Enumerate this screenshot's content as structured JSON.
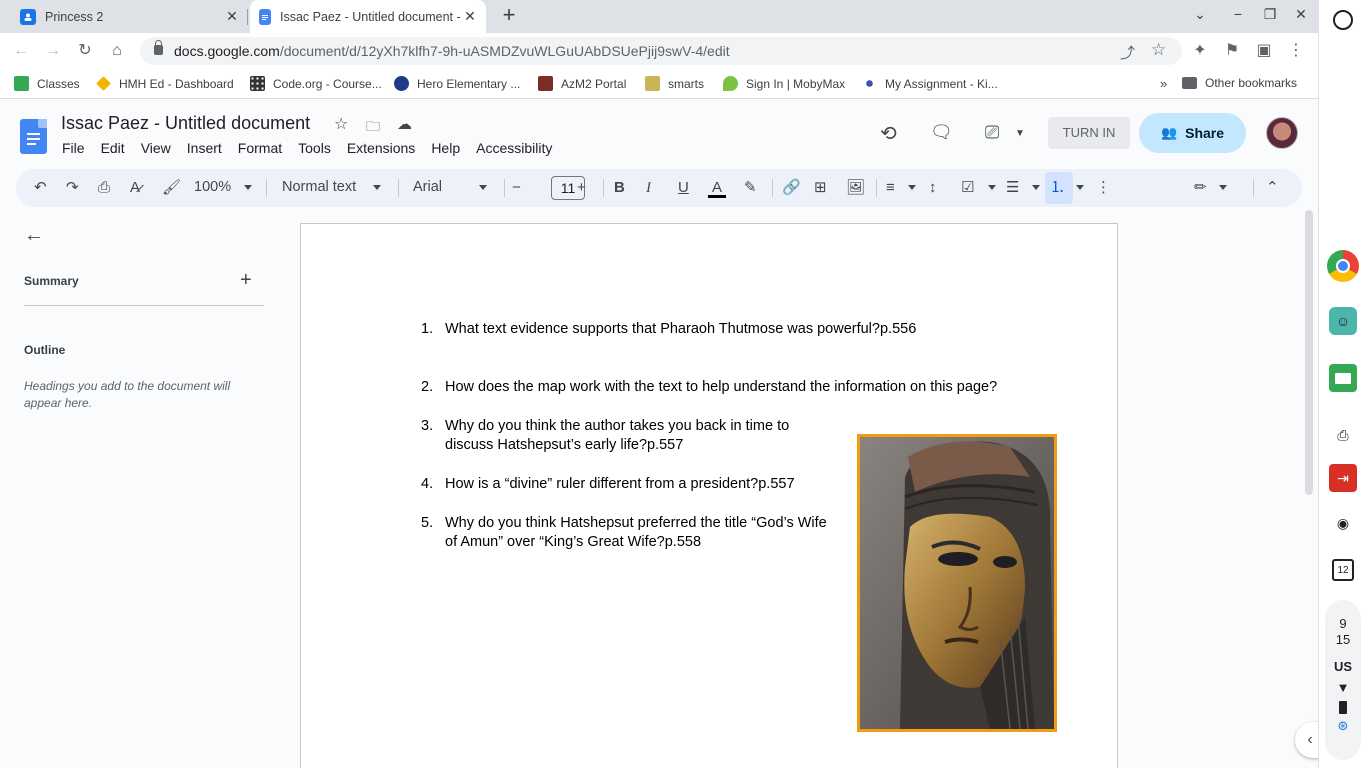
{
  "browser": {
    "tabs": [
      {
        "title": "Princess 2"
      },
      {
        "title": "Issac Paez - Untitled document -"
      }
    ],
    "url_domain": "docs.google.com",
    "url_path": "/document/d/12yXh7klfh7-9h-uASMDZvuWLGuUAbDSUePjij9swV-4/edit",
    "bookmarks": [
      "Classes",
      "HMH Ed - Dashboard",
      "Code.org - Course...",
      "Hero Elementary ...",
      "AzM2 Portal",
      "smarts",
      "Sign In | MobyMax",
      "My Assignment - Ki...",
      "Other bookmarks"
    ]
  },
  "docs": {
    "title": "Issac Paez - Untitled document",
    "menu": [
      "File",
      "Edit",
      "View",
      "Insert",
      "Format",
      "Tools",
      "Extensions",
      "Help",
      "Accessibility"
    ],
    "turn_in": "TURN IN",
    "share": "Share",
    "toolbar": {
      "zoom": "100%",
      "style": "Normal text",
      "font": "Arial",
      "font_size": "11"
    }
  },
  "sidepanel": {
    "summary": "Summary",
    "outline": "Outline",
    "hint": "Headings you add to the document will appear here."
  },
  "document": {
    "questions": [
      {
        "num": "1.",
        "lines": [
          "What text evidence supports that Pharaoh Thutmose was powerful?p.556"
        ]
      },
      {
        "num": "2.",
        "lines": [
          "How does the map work with the text to help understand the information on this page?"
        ]
      },
      {
        "num": "3.",
        "lines": [
          "Why do you think the author takes you back in time to",
          "discuss Hatshepsut’s early life?p.557"
        ]
      },
      {
        "num": "4.",
        "lines": [
          "How is a “divine” ruler different from a president?p.557"
        ]
      },
      {
        "num": "5.",
        "lines": [
          "Why do you think Hatshepsut preferred the title “God’s Wife",
          "of Amun” over “King’s Great Wife?p.558"
        ]
      }
    ]
  },
  "shelf": {
    "time_hour": "9",
    "time_min": "15",
    "locale": "US",
    "calendar_day": "12"
  },
  "colors": {
    "share_bg": "#c2e7ff",
    "toolbar_bg": "#edf2fa",
    "image_border": "#f39c12",
    "docs_blue": "#4285f4"
  }
}
